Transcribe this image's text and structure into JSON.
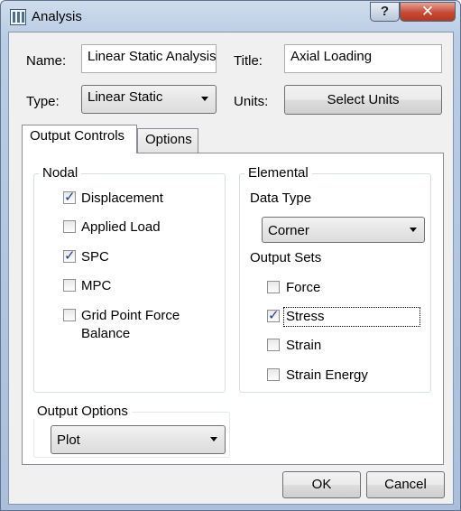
{
  "window": {
    "title": "Analysis",
    "help_label": "?",
    "close_label": "✕"
  },
  "form": {
    "name_label": "Name:",
    "name_value": "Linear Static Analysis",
    "title_label": "Title:",
    "title_value": "Axial Loading",
    "type_label": "Type:",
    "type_value": "Linear Static",
    "units_label": "Units:",
    "select_units_label": "Select Units"
  },
  "tabs": [
    {
      "label": "Output Controls",
      "active": true
    },
    {
      "label": "Options",
      "active": false
    }
  ],
  "nodal": {
    "title": "Nodal",
    "items": [
      {
        "label": "Displacement",
        "checked": true
      },
      {
        "label": "Applied Load",
        "checked": false
      },
      {
        "label": "SPC",
        "checked": true
      },
      {
        "label": "MPC",
        "checked": false
      },
      {
        "label": "Grid Point Force",
        "label2": "Balance",
        "checked": false
      }
    ]
  },
  "elemental": {
    "title": "Elemental",
    "data_type_label": "Data Type",
    "data_type_value": "Corner",
    "output_sets_label": "Output Sets",
    "items": [
      {
        "label": "Force",
        "checked": false
      },
      {
        "label": "Stress",
        "checked": true,
        "focused": true
      },
      {
        "label": "Strain",
        "checked": false
      },
      {
        "label": "Strain Energy",
        "checked": false
      }
    ]
  },
  "output_options": {
    "title": "Output Options",
    "value": "Plot"
  },
  "footer": {
    "ok_label": "OK",
    "cancel_label": "Cancel"
  },
  "check_glyph": "✓"
}
